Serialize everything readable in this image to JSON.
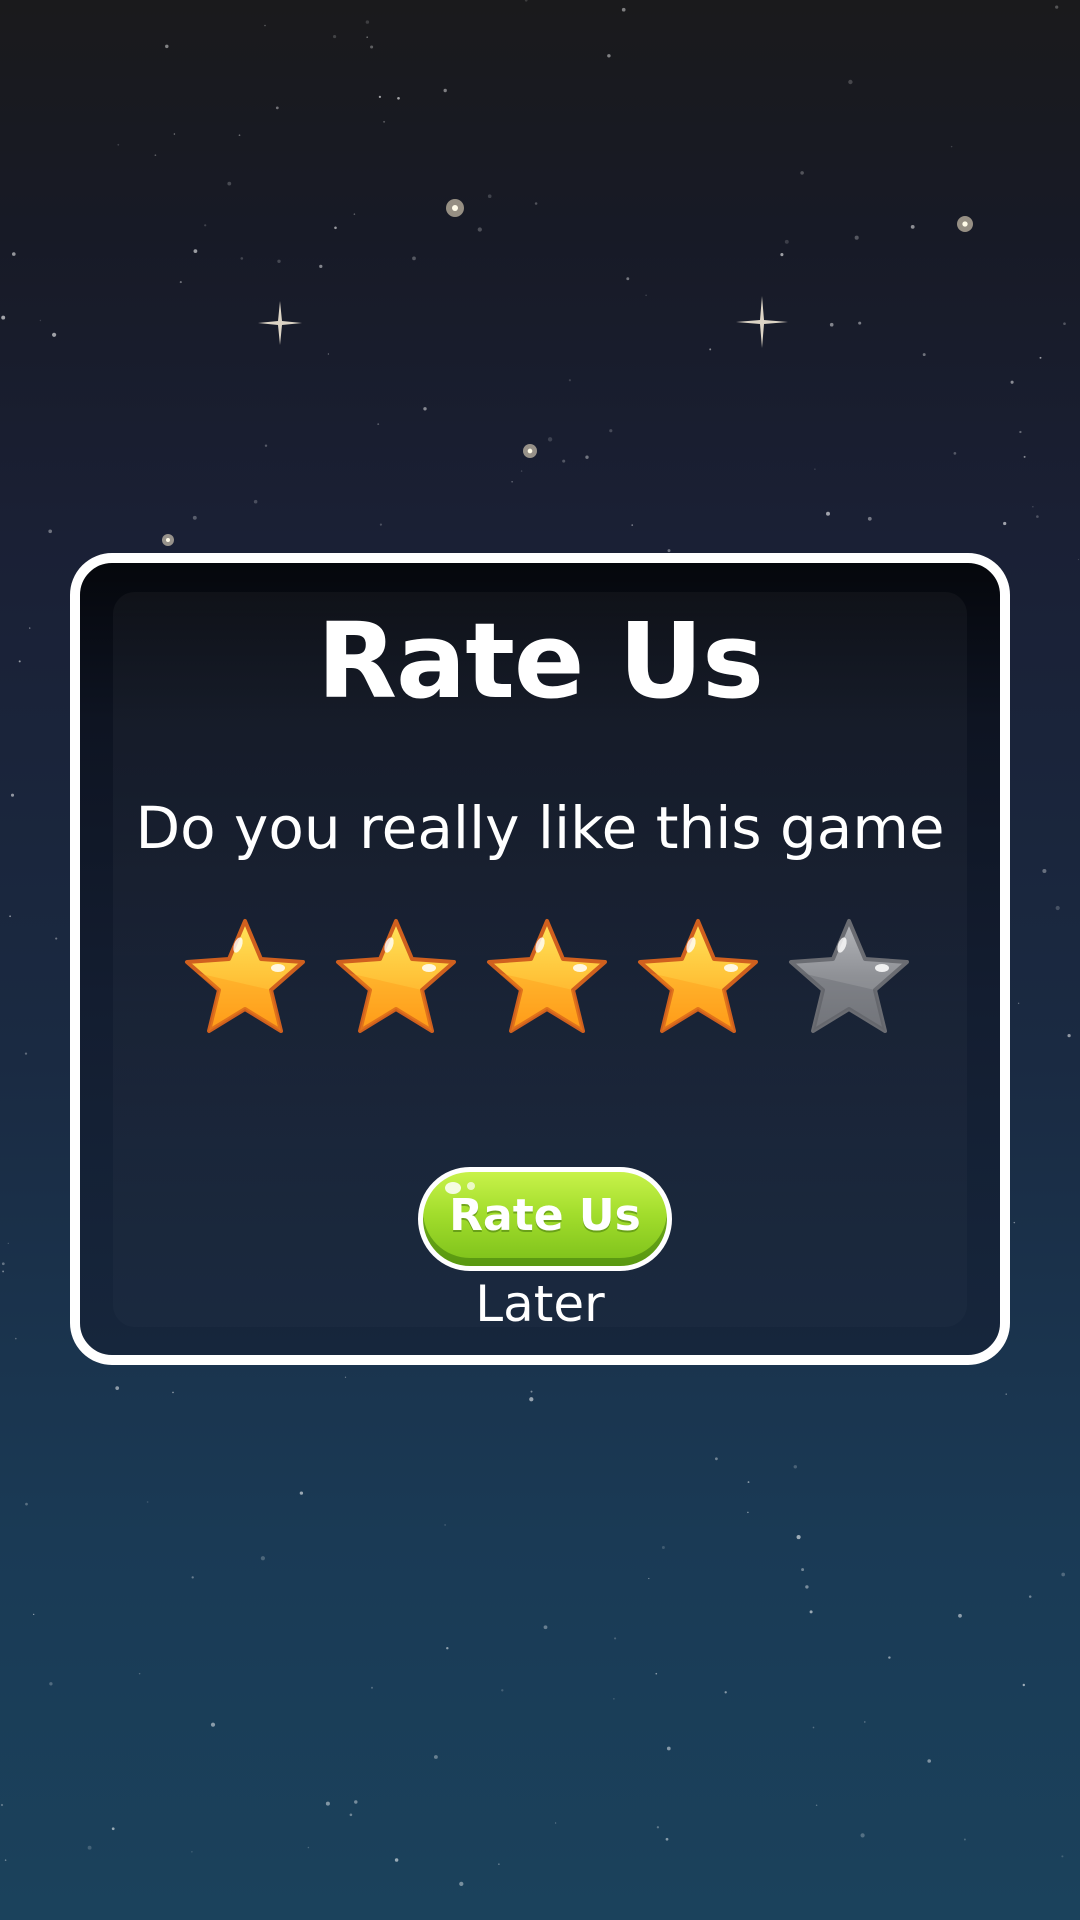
{
  "dialog": {
    "title": "Rate Us",
    "question": "Do you really like this game",
    "rating": {
      "value": 4,
      "max": 5
    },
    "rate_button_label": "Rate Us",
    "later_label": "Later"
  },
  "colors": {
    "star_filled": "#ffc43a",
    "star_filled_outline": "#d0601e",
    "star_empty": "#8f9196",
    "star_empty_outline": "#6a6c72",
    "button_green": "#9bd82b",
    "panel_border": "#ffffff"
  },
  "icons": {
    "star_filled": "star-filled-icon",
    "star_empty": "star-empty-icon"
  }
}
